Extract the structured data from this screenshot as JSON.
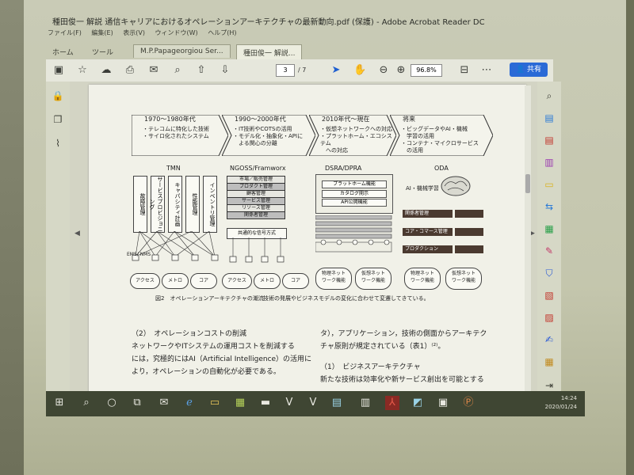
{
  "window": {
    "title": "種田俊一 解説 通信キャリアにおけるオペレーションアーキテクチャの最新動向.pdf (保護) - Adobe Acrobat Reader DC"
  },
  "menu": [
    "ファイル(F)",
    "編集(E)",
    "表示(V)",
    "ウィンドウ(W)",
    "ヘルプ(H)"
  ],
  "tabs": [
    "ホーム",
    "ツール",
    "M.P.Papageorgiou Ser...",
    "種田俊一 解説..."
  ],
  "toolbar": {
    "page_current": "3",
    "page_total": "/ 7",
    "zoom": "96.8%",
    "share_label": "共有"
  },
  "figure": {
    "timeline": [
      {
        "era": "1970〜1980年代",
        "items": [
          "・テレコムに特化した技術",
          "・サイロ化されたシステム"
        ]
      },
      {
        "era": "1990〜2000年代",
        "items": [
          "・IT技術やCOTSの活用",
          "・モデル化・抽象化・APIに",
          "　よる関心の分離"
        ]
      },
      {
        "era": "2010年代〜現在",
        "items": [
          "・仮想ネットワークへの対応",
          "・プラットホーム・エコシステム",
          "　への対応"
        ]
      },
      {
        "era": "将来",
        "items": [
          "・ビッグデータやAI・機械",
          "　学習の活用",
          "・コンテナ・マイクロサービス",
          "　の活用"
        ]
      }
    ],
    "columns": {
      "tmn": "TMN",
      "ngoss": "NGOSS/Framworx",
      "dsra": "DSRA/DPRA",
      "oda": "ODA"
    },
    "tmn_boxes": [
      "故障管理",
      "サービスプロビジョニング",
      "キャパシティ計画",
      "性能管理",
      "インベントリ管理"
    ],
    "ngoss_boxes": [
      "市場／販売管理",
      "プロダクト管理",
      "顧客管理",
      "サービス管理",
      "リソース管理",
      "関係者管理"
    ],
    "ngoss_signal": "共通的な信号方式",
    "dsra_boxes": [
      "プラットホーム機能",
      "カタログ開示",
      "API公開機能"
    ],
    "oda_ai": "AI・機械学習",
    "oda_rows": [
      "関係者管理",
      "コア・コマース管理",
      "プロダクション"
    ],
    "ems": "EMS/\nNMS",
    "clouds_tmn": [
      "アクセス",
      "メトロ",
      "コア"
    ],
    "clouds_ngoss": [
      "アクセス",
      "メトロ",
      "コア"
    ],
    "clouds_dsra": [
      "物理ネット\nワーク機能",
      "仮想ネット\nワーク機能"
    ],
    "clouds_oda": [
      "物理ネット\nワーク機能",
      "仮想ネット\nワーク機能"
    ],
    "caption_title": "図2　オペレーションアーキテクチャの潮流",
    "caption_text": "技術の発展やビジネスモデルの変化に合わせて変遷してきている。"
  },
  "body": {
    "left_heading": "（2）　オペレーションコストの削減",
    "left_lines": [
      "ネットワークやITシステムの運用コストを削減する",
      "には，究極的にはAI（Artificial Intelligence）の活用に",
      "より，オペレーションの自動化が必要である。"
    ],
    "right_lines": [
      "タ），アプリケーション，技術の側面からアーキテク",
      "チャ原則が規定されている（表1）⁽²⁾。",
      "",
      "（1）　ビジネスアーキテクチャ",
      "新たな技術は効率化や新サービス創出を可能とする"
    ]
  },
  "taskbar": {
    "time": "14:24",
    "date": "2020/01/24"
  }
}
